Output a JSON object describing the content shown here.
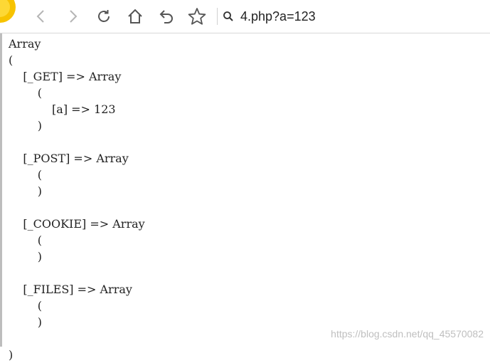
{
  "browser": {
    "url": "4.php?a=123"
  },
  "icons": {
    "back": "chevron-left-icon",
    "forward": "chevron-right-icon",
    "reload": "reload-icon",
    "home": "home-icon",
    "undo": "undo-icon",
    "favorite": "star-icon",
    "search": "search-icon"
  },
  "page": {
    "dump": "Array\n(\n    [_GET] => Array\n        (\n            [a] => 123\n        )\n\n    [_POST] => Array\n        (\n        )\n\n    [_COOKIE] => Array\n        (\n        )\n\n    [_FILES] => Array\n        (\n        )\n\n)"
  },
  "watermark": "https://blog.csdn.net/qq_45570082",
  "colors": {
    "icon": "#555555",
    "icon_disabled": "#b5b5b5",
    "logo": "#f7c300"
  }
}
